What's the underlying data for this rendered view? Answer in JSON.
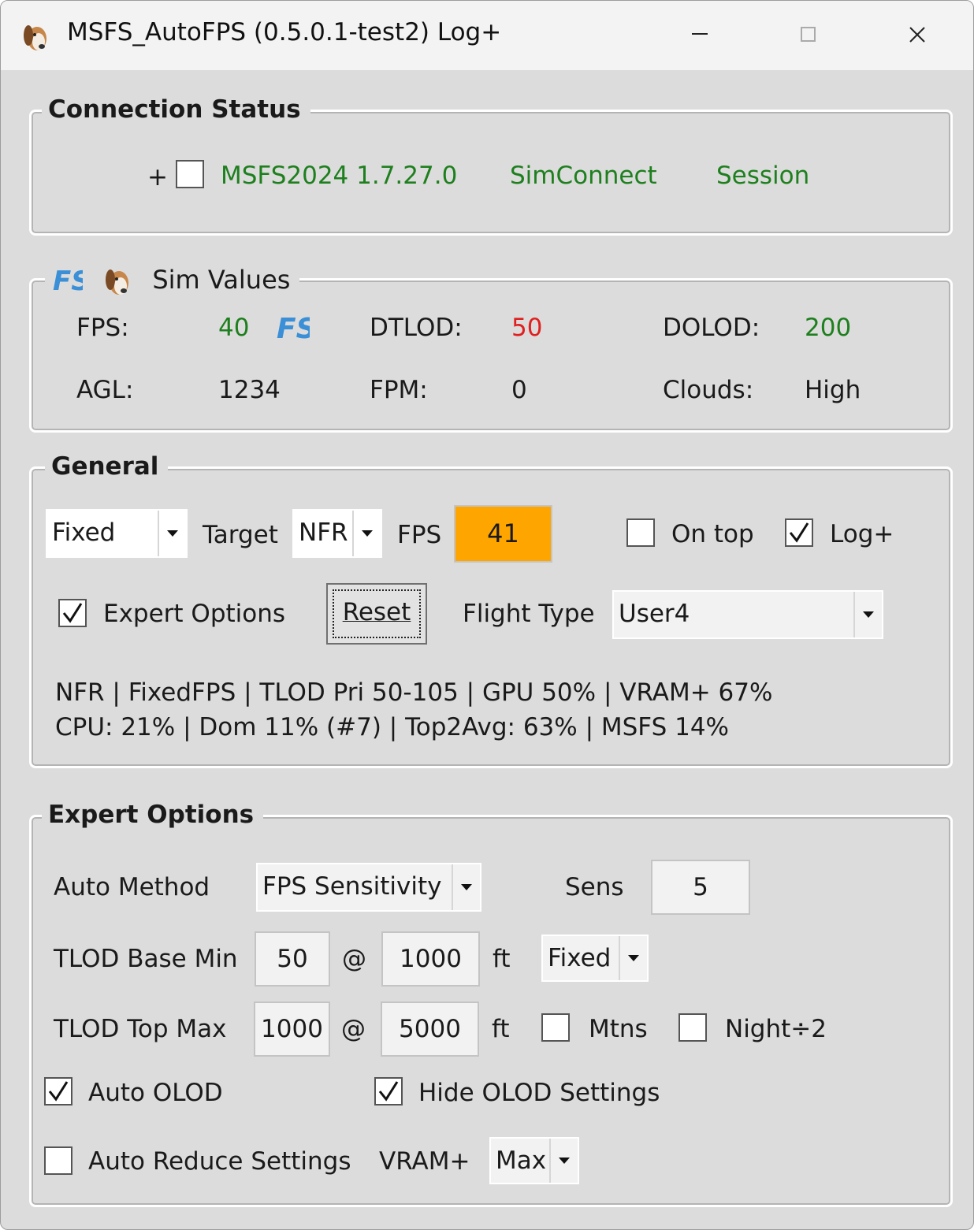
{
  "window": {
    "title": "MSFS_AutoFPS (0.5.0.1-test2) Log+",
    "controls": [
      "minimize-icon",
      "maximize-icon",
      "close-icon"
    ]
  },
  "connection": {
    "legend": "Connection Status",
    "prefix": "+",
    "checkbox_checked": false,
    "sim_version": "MSFS2024 1.7.27.0",
    "simconnect": "SimConnect",
    "session": "Session",
    "status_color": "#1e7f1e"
  },
  "sim_values": {
    "legend": "Sim Values",
    "fps_label": "FPS:",
    "fps_value": "40",
    "dtlod_label": "DTLOD:",
    "dtlod_value": "50",
    "dolod_label": "DOLOD:",
    "dolod_value": "200",
    "agl_label": "AGL:",
    "agl_value": "1234",
    "fpm_label": "FPM:",
    "fpm_value": "0",
    "clouds_label": "Clouds:",
    "clouds_value": "High",
    "fs_logo_text": "FS",
    "colors": {
      "good": "#1e7f1e",
      "warn": "#e02020"
    }
  },
  "general": {
    "legend": "General",
    "mode_value": "Fixed",
    "target_label": "Target",
    "target_value": "NFR",
    "fps_label": "FPS",
    "fps_value": "41",
    "fps_box_color": "#ffa500",
    "ontop_label": "On top",
    "ontop_checked": false,
    "logplus_label": "Log+",
    "logplus_checked": true,
    "expert_label": "Expert Options",
    "expert_checked": true,
    "reset_label": "Reset",
    "flight_type_label": "Flight Type",
    "flight_type_value": "User4",
    "status_line1": "NFR | FixedFPS | TLOD Pri 50-105 | GPU 50% | VRAM+ 67%",
    "status_line2": "CPU: 21% | Dom 11% (#7) | Top2Avg: 63% | MSFS 14%"
  },
  "expert": {
    "legend": "Expert Options",
    "auto_method_label": "Auto Method",
    "auto_method_value": "FPS Sensitivity",
    "sens_label": "Sens",
    "sens_value": "5",
    "tlod_base_label": "TLOD Base Min",
    "tlod_base_value": "50",
    "at1": "@",
    "tlod_base_alt": "1000",
    "ft1": "ft",
    "base_mode_value": "Fixed",
    "tlod_top_label": "TLOD Top Max",
    "tlod_top_value": "1000",
    "at2": "@",
    "tlod_top_alt": "5000",
    "ft2": "ft",
    "mtns_label": "Mtns",
    "mtns_checked": false,
    "night_label": "Night÷2",
    "night_checked": false,
    "auto_olod_label": "Auto OLOD",
    "auto_olod_checked": true,
    "hide_olod_label": "Hide OLOD Settings",
    "hide_olod_checked": true,
    "auto_reduce_label": "Auto Reduce Settings",
    "auto_reduce_checked": false,
    "vram_label": "VRAM+",
    "vram_value": "Max"
  }
}
